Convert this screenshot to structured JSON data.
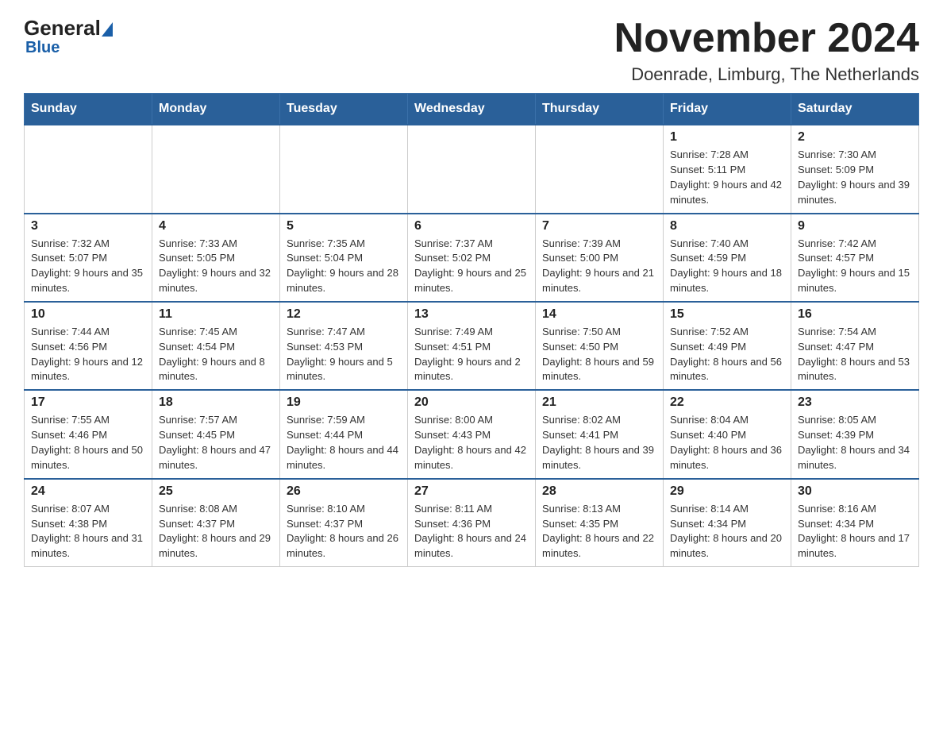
{
  "logo": {
    "general": "General",
    "blue": "Blue",
    "subtitle": "Blue"
  },
  "header": {
    "month_year": "November 2024",
    "location": "Doenrade, Limburg, The Netherlands"
  },
  "weekdays": [
    "Sunday",
    "Monday",
    "Tuesday",
    "Wednesday",
    "Thursday",
    "Friday",
    "Saturday"
  ],
  "weeks": [
    [
      {
        "day": "",
        "info": ""
      },
      {
        "day": "",
        "info": ""
      },
      {
        "day": "",
        "info": ""
      },
      {
        "day": "",
        "info": ""
      },
      {
        "day": "",
        "info": ""
      },
      {
        "day": "1",
        "info": "Sunrise: 7:28 AM\nSunset: 5:11 PM\nDaylight: 9 hours and 42 minutes."
      },
      {
        "day": "2",
        "info": "Sunrise: 7:30 AM\nSunset: 5:09 PM\nDaylight: 9 hours and 39 minutes."
      }
    ],
    [
      {
        "day": "3",
        "info": "Sunrise: 7:32 AM\nSunset: 5:07 PM\nDaylight: 9 hours and 35 minutes."
      },
      {
        "day": "4",
        "info": "Sunrise: 7:33 AM\nSunset: 5:05 PM\nDaylight: 9 hours and 32 minutes."
      },
      {
        "day": "5",
        "info": "Sunrise: 7:35 AM\nSunset: 5:04 PM\nDaylight: 9 hours and 28 minutes."
      },
      {
        "day": "6",
        "info": "Sunrise: 7:37 AM\nSunset: 5:02 PM\nDaylight: 9 hours and 25 minutes."
      },
      {
        "day": "7",
        "info": "Sunrise: 7:39 AM\nSunset: 5:00 PM\nDaylight: 9 hours and 21 minutes."
      },
      {
        "day": "8",
        "info": "Sunrise: 7:40 AM\nSunset: 4:59 PM\nDaylight: 9 hours and 18 minutes."
      },
      {
        "day": "9",
        "info": "Sunrise: 7:42 AM\nSunset: 4:57 PM\nDaylight: 9 hours and 15 minutes."
      }
    ],
    [
      {
        "day": "10",
        "info": "Sunrise: 7:44 AM\nSunset: 4:56 PM\nDaylight: 9 hours and 12 minutes."
      },
      {
        "day": "11",
        "info": "Sunrise: 7:45 AM\nSunset: 4:54 PM\nDaylight: 9 hours and 8 minutes."
      },
      {
        "day": "12",
        "info": "Sunrise: 7:47 AM\nSunset: 4:53 PM\nDaylight: 9 hours and 5 minutes."
      },
      {
        "day": "13",
        "info": "Sunrise: 7:49 AM\nSunset: 4:51 PM\nDaylight: 9 hours and 2 minutes."
      },
      {
        "day": "14",
        "info": "Sunrise: 7:50 AM\nSunset: 4:50 PM\nDaylight: 8 hours and 59 minutes."
      },
      {
        "day": "15",
        "info": "Sunrise: 7:52 AM\nSunset: 4:49 PM\nDaylight: 8 hours and 56 minutes."
      },
      {
        "day": "16",
        "info": "Sunrise: 7:54 AM\nSunset: 4:47 PM\nDaylight: 8 hours and 53 minutes."
      }
    ],
    [
      {
        "day": "17",
        "info": "Sunrise: 7:55 AM\nSunset: 4:46 PM\nDaylight: 8 hours and 50 minutes."
      },
      {
        "day": "18",
        "info": "Sunrise: 7:57 AM\nSunset: 4:45 PM\nDaylight: 8 hours and 47 minutes."
      },
      {
        "day": "19",
        "info": "Sunrise: 7:59 AM\nSunset: 4:44 PM\nDaylight: 8 hours and 44 minutes."
      },
      {
        "day": "20",
        "info": "Sunrise: 8:00 AM\nSunset: 4:43 PM\nDaylight: 8 hours and 42 minutes."
      },
      {
        "day": "21",
        "info": "Sunrise: 8:02 AM\nSunset: 4:41 PM\nDaylight: 8 hours and 39 minutes."
      },
      {
        "day": "22",
        "info": "Sunrise: 8:04 AM\nSunset: 4:40 PM\nDaylight: 8 hours and 36 minutes."
      },
      {
        "day": "23",
        "info": "Sunrise: 8:05 AM\nSunset: 4:39 PM\nDaylight: 8 hours and 34 minutes."
      }
    ],
    [
      {
        "day": "24",
        "info": "Sunrise: 8:07 AM\nSunset: 4:38 PM\nDaylight: 8 hours and 31 minutes."
      },
      {
        "day": "25",
        "info": "Sunrise: 8:08 AM\nSunset: 4:37 PM\nDaylight: 8 hours and 29 minutes."
      },
      {
        "day": "26",
        "info": "Sunrise: 8:10 AM\nSunset: 4:37 PM\nDaylight: 8 hours and 26 minutes."
      },
      {
        "day": "27",
        "info": "Sunrise: 8:11 AM\nSunset: 4:36 PM\nDaylight: 8 hours and 24 minutes."
      },
      {
        "day": "28",
        "info": "Sunrise: 8:13 AM\nSunset: 4:35 PM\nDaylight: 8 hours and 22 minutes."
      },
      {
        "day": "29",
        "info": "Sunrise: 8:14 AM\nSunset: 4:34 PM\nDaylight: 8 hours and 20 minutes."
      },
      {
        "day": "30",
        "info": "Sunrise: 8:16 AM\nSunset: 4:34 PM\nDaylight: 8 hours and 17 minutes."
      }
    ]
  ]
}
